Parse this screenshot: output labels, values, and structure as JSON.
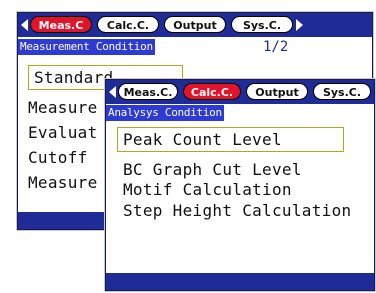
{
  "back_screen": {
    "tabs": [
      {
        "label": "Meas.C",
        "active": true
      },
      {
        "label": "Calc.C.",
        "active": false
      },
      {
        "label": "Output",
        "active": false
      },
      {
        "label": "Sys.C.",
        "active": false
      }
    ],
    "subheader": "Measurement Condition",
    "page": "1/2",
    "items": [
      "Standard",
      "Measure",
      "Evaluat",
      "Cutoff",
      "Measure"
    ]
  },
  "front_screen": {
    "tabs": [
      {
        "label": "Meas.C.",
        "active": false
      },
      {
        "label": "Calc.C.",
        "active": true
      },
      {
        "label": "Output",
        "active": false
      },
      {
        "label": "Sys.C.",
        "active": false
      }
    ],
    "subheader": "Analysys Condition",
    "items": [
      "Peak Count Level",
      "BC Graph Cut Level",
      "Motif Calculation",
      "Step Height Calculation"
    ]
  },
  "colors": {
    "bar_blue": "#1f2b97",
    "header_blue": "#2d3ad3",
    "active_tab_red": "#e3142a",
    "selection_border": "#b8a51a"
  },
  "icons": {
    "left": "triangle-left",
    "right": "triangle-right"
  }
}
